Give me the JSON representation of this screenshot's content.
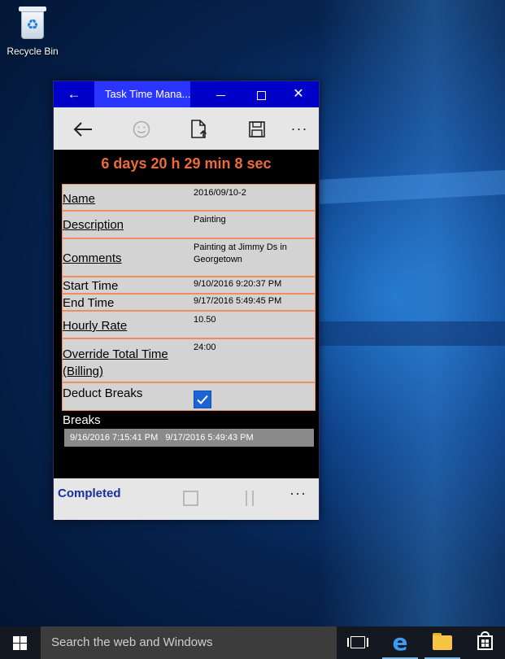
{
  "desktop": {
    "recycle_bin_label": "Recycle Bin"
  },
  "window": {
    "title": "Task Time Mana...",
    "commands": {
      "back_icon": "arrow-left-icon",
      "smile_icon": "smile-icon",
      "upload_icon": "upload-file-icon",
      "save_icon": "save-icon",
      "more_icon": "more-icon"
    },
    "timer": "6 days 20 h 29 min 8 sec",
    "fields": [
      {
        "label": "Name",
        "value": "2016/09/10-2"
      },
      {
        "label": "Description",
        "value": "Painting"
      },
      {
        "label": "Comments",
        "value": "Painting at Jimmy Ds in Georgetown"
      },
      {
        "label": "Start Time",
        "value": "9/10/2016 9:20:37 PM"
      },
      {
        "label": "End Time",
        "value": "9/17/2016 5:49:45 PM"
      },
      {
        "label": "Hourly Rate",
        "value": "10.50"
      },
      {
        "label": "Override Total Time (Billing)",
        "value": "24:00"
      },
      {
        "label": "Deduct Breaks",
        "checked": true
      }
    ],
    "breaks": {
      "title": "Breaks",
      "items": [
        {
          "start": "9/16/2016 7:15:41 PM",
          "end": "9/17/2016 5:49:43 PM"
        }
      ]
    },
    "status": "Completed"
  },
  "taskbar": {
    "search_placeholder": "Search the web and Windows"
  },
  "colors": {
    "title_bar": "#0000c8",
    "timer": "#ef6a3a",
    "field_border": "#ef8d5c",
    "status": "#1a2d9e",
    "checkbox": "#1a64d4"
  }
}
